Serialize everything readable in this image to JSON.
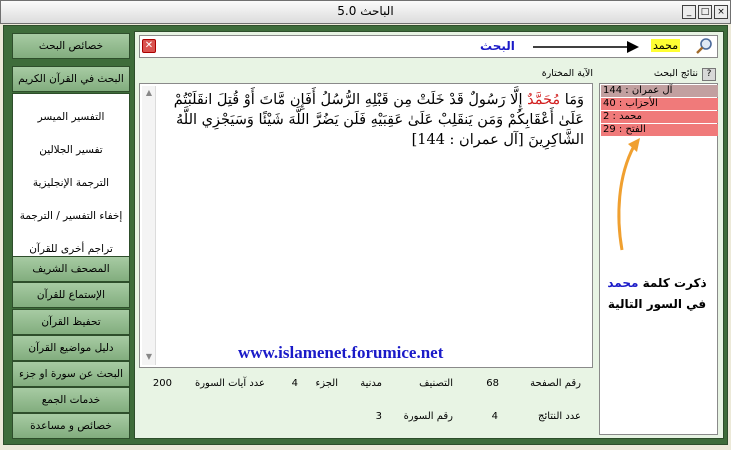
{
  "window": {
    "title": "الباحث 5.0",
    "buttons": [
      "_",
      "□",
      "×"
    ]
  },
  "sidebar": {
    "top_button": "خصائص البحث",
    "search_quran_button": "البحث في القرآن الكريم",
    "sub_items": [
      "التفسير الميسر",
      "تفسير الجلالين",
      "الترجمة الإنجليزية",
      "إخفاء التفسير / الترجمة",
      "تراجم أخرى للقرآن"
    ],
    "bottom_buttons": [
      "المصحف الشريف",
      "الإستماع للقرآن",
      "تحفيظ القرآن",
      "دليل مواضيع القرآن",
      "البحث عن سورة او جزء",
      "خدمات الجمع",
      "خصائص و مساعدة"
    ]
  },
  "search": {
    "label": "البحث",
    "value": "محمد",
    "clear_icon": "close-icon",
    "search_icon": "magnifier-icon"
  },
  "verse": {
    "header": "الآية المختارة",
    "text_before": "وَمَا ",
    "highlight": "مُحَمَّدٌ",
    "text_after": " إِلَّا رَسُولٌ قَدْ خَلَتْ مِن قَبْلِهِ الرُّسُلُ أَفَإِن مَّاتَ أَوْ قُتِلَ انقَلَبْتُمْ عَلَىٰ أَعْقَابِكُمْ وَمَن يَنقَلِبْ عَلَىٰ عَقِبَيْهِ فَلَن يَضُرَّ اللَّهَ شَيْئًا وَسَيَجْزِي اللَّهُ الشَّاكِرِينَ [آل عمران : 144]",
    "website": "www.islamenet.forumice.net"
  },
  "info": {
    "page_label": "رقم الصفحة",
    "page_value": "68",
    "class_label": "التصنيف",
    "class_value": "مدنية",
    "juz_label": "الجزء",
    "juz_value": "4",
    "ayat_label": "عدد آيات السورة",
    "ayat_value": "200",
    "results_label": "عدد النتائج",
    "results_value": "4",
    "surah_label": "رقم السورة",
    "surah_value": "3"
  },
  "results": {
    "header": "نتائج البحث",
    "help_button": "?",
    "rows": [
      "آل عمران : 144",
      "الأحزاب : 40",
      "محمد : 2",
      "الفتح : 29"
    ]
  },
  "callout": {
    "line1_a": "ذكرت كلمة",
    "line1_b": "محمد",
    "line2": "في السور التالية"
  },
  "colors": {
    "frame": "#3e6c3a",
    "button": "#a7cba3",
    "panel": "#e8f4e4",
    "result_row": "#f07a7a",
    "highlight": "#ffff33",
    "accent_blue": "#1a1ac8"
  }
}
